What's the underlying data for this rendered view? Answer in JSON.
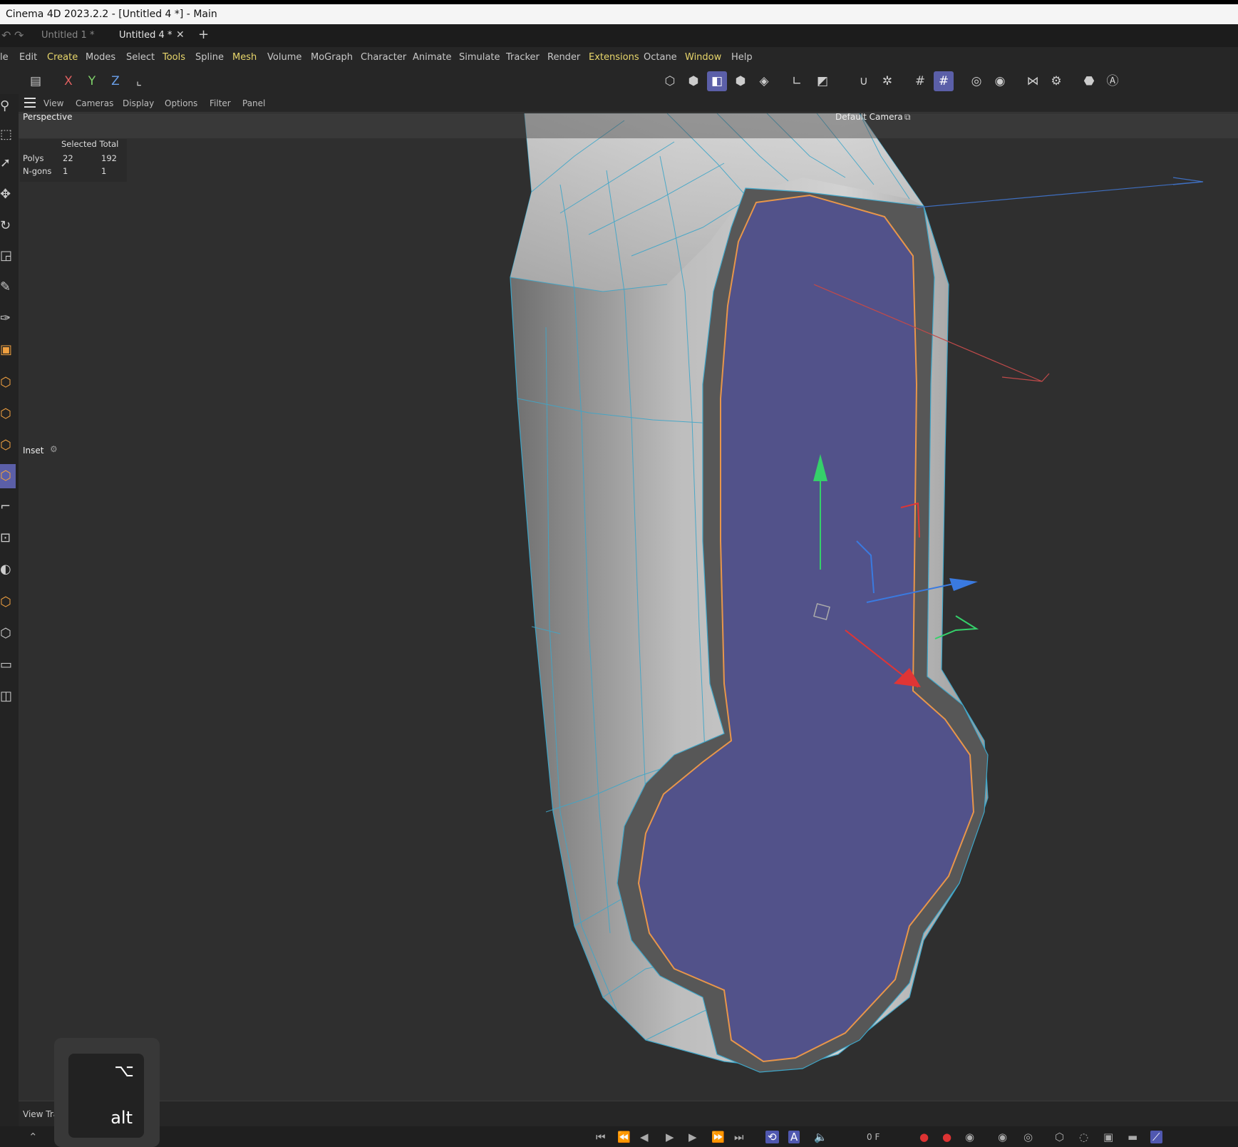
{
  "window": {
    "title": "Cinema 4D 2023.2.2 - [Untitled 4 *] - Main"
  },
  "tabs": [
    {
      "label": "Untitled 1 *"
    },
    {
      "label": "Untitled 4 *"
    }
  ],
  "tab_close": "✕",
  "tab_add": "+",
  "menu": {
    "items": [
      "le",
      "Edit",
      "Create",
      "Modes",
      "Select",
      "Tools",
      "Spline",
      "Mesh",
      "Volume",
      "MoGraph",
      "Character",
      "Animate",
      "Simulate",
      "Tracker",
      "Render",
      "Extensions",
      "Octane",
      "Window",
      "Help"
    ]
  },
  "toolbar": {
    "x": "X",
    "y": "Y",
    "z": "Z"
  },
  "viewport": {
    "menu": [
      "View",
      "Cameras",
      "Display",
      "Options",
      "Filter",
      "Panel"
    ],
    "label": "Perspective",
    "camera": "Default Camera",
    "stats": {
      "header": "Selected Total",
      "rows": [
        {
          "name": "Polys",
          "selected": "22",
          "total": "192"
        },
        {
          "name": "N-gons",
          "selected": "1",
          "total": "1"
        }
      ]
    },
    "tool_label": "Inset"
  },
  "status": {
    "text": "View Trans"
  },
  "timeline": {
    "frame": "0 F"
  },
  "key_overlay": {
    "symbol": "⌥",
    "label": "alt"
  },
  "colors": {
    "accent": "#5b5fa8",
    "selected_face": "#52528a",
    "wireframe": "#3fa6c8",
    "selection_edge": "#e8964a"
  }
}
